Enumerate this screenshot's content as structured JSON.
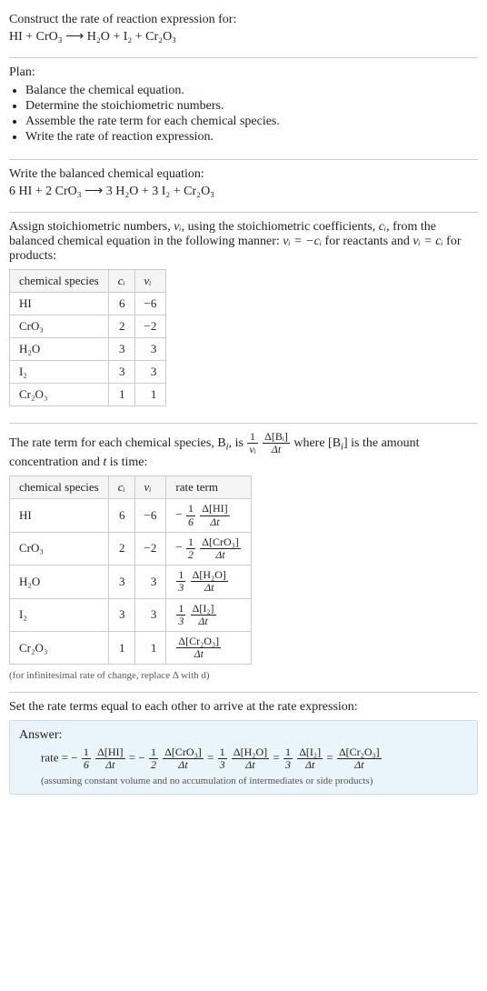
{
  "title": "Construct the rate of reaction expression for:",
  "unbalanced": {
    "lhs": "HI + CrO₃",
    "arrow": "⟶",
    "rhs": "H₂O + I₂ + Cr₂O₃"
  },
  "plan_label": "Plan:",
  "plan_items": [
    "Balance the chemical equation.",
    "Determine the stoichiometric numbers.",
    "Assemble the rate term for each chemical species.",
    "Write the rate of reaction expression."
  ],
  "balanced_label": "Write the balanced chemical equation:",
  "balanced": {
    "lhs": "6 HI + 2 CrO₃",
    "arrow": "⟶",
    "rhs": "3 H₂O + 3 I₂ + Cr₂O₃"
  },
  "assign_text_1": "Assign stoichiometric numbers, ",
  "assign_nu": "νᵢ",
  "assign_text_2": ", using the stoichiometric coefficients, ",
  "assign_c": "cᵢ",
  "assign_text_3": ", from the balanced chemical equation in the following manner: ",
  "assign_eq1": "νᵢ = −cᵢ",
  "assign_text_4": " for reactants and ",
  "assign_eq2": "νᵢ = cᵢ",
  "assign_text_5": " for products:",
  "table1_headers": {
    "species": "chemical species",
    "c": "cᵢ",
    "nu": "νᵢ"
  },
  "table1_rows": [
    {
      "sp": "HI",
      "c": "6",
      "nu": "−6"
    },
    {
      "sp": "CrO₃",
      "c": "2",
      "nu": "−2"
    },
    {
      "sp": "H₂O",
      "c": "3",
      "nu": "3"
    },
    {
      "sp": "I₂",
      "c": "3",
      "nu": "3"
    },
    {
      "sp": "Cr₂O₃",
      "c": "1",
      "nu": "1"
    }
  ],
  "rateterm_text_1": "The rate term for each chemical species, B",
  "rateterm_text_2": ", is ",
  "rateterm_frac1_num": "1",
  "rateterm_frac1_den": "νᵢ",
  "rateterm_frac2_num": "Δ[Bᵢ]",
  "rateterm_frac2_den": "Δt",
  "rateterm_text_3": " where [B",
  "rateterm_text_4": "] is the amount concentration and ",
  "rateterm_t": "t",
  "rateterm_text_5": " is time:",
  "table2_headers": {
    "species": "chemical species",
    "c": "cᵢ",
    "nu": "νᵢ",
    "rate": "rate term"
  },
  "table2_rows": [
    {
      "sp": "HI",
      "c": "6",
      "nu": "−6",
      "sign": "−",
      "coef_num": "1",
      "coef_den": "6",
      "d_num": "Δ[HI]",
      "d_den": "Δt"
    },
    {
      "sp": "CrO₃",
      "c": "2",
      "nu": "−2",
      "sign": "−",
      "coef_num": "1",
      "coef_den": "2",
      "d_num": "Δ[CrO₃]",
      "d_den": "Δt"
    },
    {
      "sp": "H₂O",
      "c": "3",
      "nu": "3",
      "sign": "",
      "coef_num": "1",
      "coef_den": "3",
      "d_num": "Δ[H₂O]",
      "d_den": "Δt"
    },
    {
      "sp": "I₂",
      "c": "3",
      "nu": "3",
      "sign": "",
      "coef_num": "1",
      "coef_den": "3",
      "d_num": "Δ[I₂]",
      "d_den": "Δt"
    },
    {
      "sp": "Cr₂O₃",
      "c": "1",
      "nu": "1",
      "sign": "",
      "coef_num": "",
      "coef_den": "",
      "d_num": "Δ[Cr₂O₃]",
      "d_den": "Δt"
    }
  ],
  "footnote": "(for infinitesimal rate of change, replace Δ with d)",
  "set_equal": "Set the rate terms equal to each other to arrive at the rate expression:",
  "answer_label": "Answer:",
  "answer_prefix": "rate = ",
  "answer_terms": [
    {
      "sign": "−",
      "coef_num": "1",
      "coef_den": "6",
      "d_num": "Δ[HI]",
      "d_den": "Δt"
    },
    {
      "sign": "−",
      "coef_num": "1",
      "coef_den": "2",
      "d_num": "Δ[CrO₃]",
      "d_den": "Δt"
    },
    {
      "sign": "",
      "coef_num": "1",
      "coef_den": "3",
      "d_num": "Δ[H₂O]",
      "d_den": "Δt"
    },
    {
      "sign": "",
      "coef_num": "1",
      "coef_den": "3",
      "d_num": "Δ[I₂]",
      "d_den": "Δt"
    },
    {
      "sign": "",
      "coef_num": "",
      "coef_den": "",
      "d_num": "Δ[Cr₂O₃]",
      "d_den": "Δt"
    }
  ],
  "answer_eq": " = ",
  "answer_note": "(assuming constant volume and no accumulation of intermediates or side products)"
}
